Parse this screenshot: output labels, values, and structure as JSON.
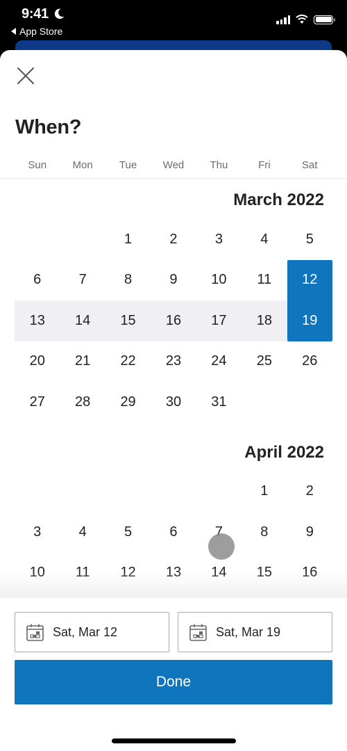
{
  "status_bar": {
    "time": "9:41",
    "back_label": "App Store",
    "icons": [
      "moon-icon",
      "cellular-signal-icon",
      "wifi-icon",
      "battery-icon"
    ]
  },
  "sheet": {
    "close_icon": "close-icon",
    "title": "When?",
    "weekdays": [
      "Sun",
      "Mon",
      "Tue",
      "Wed",
      "Thu",
      "Fri",
      "Sat"
    ]
  },
  "months": [
    {
      "title": "March 2022",
      "leading_blanks": 2,
      "days": [
        "1",
        "2",
        "3",
        "4",
        "5",
        "6",
        "7",
        "8",
        "9",
        "10",
        "11",
        "12",
        "13",
        "14",
        "15",
        "16",
        "17",
        "18",
        "19",
        "20",
        "21",
        "22",
        "23",
        "24",
        "25",
        "26",
        "27",
        "28",
        "29",
        "30",
        "31"
      ],
      "selected": [
        "12",
        "19"
      ],
      "in_range": [
        "13",
        "14",
        "15",
        "16",
        "17",
        "18"
      ]
    },
    {
      "title": "April 2022",
      "leading_blanks": 5,
      "days": [
        "1",
        "2",
        "3",
        "4",
        "5",
        "6",
        "7",
        "8",
        "9",
        "10",
        "11",
        "12",
        "13",
        "14",
        "15",
        "16"
      ],
      "selected": [],
      "in_range": []
    }
  ],
  "range": {
    "start_label": "Sat, Mar 12",
    "end_label": "Sat, Mar 19",
    "field_icon": "calendar-icon"
  },
  "actions": {
    "done_label": "Done"
  },
  "colors": {
    "accent": "#0f75bd",
    "range_background": "#f0eff3",
    "behind_card": "#0b3a86"
  }
}
